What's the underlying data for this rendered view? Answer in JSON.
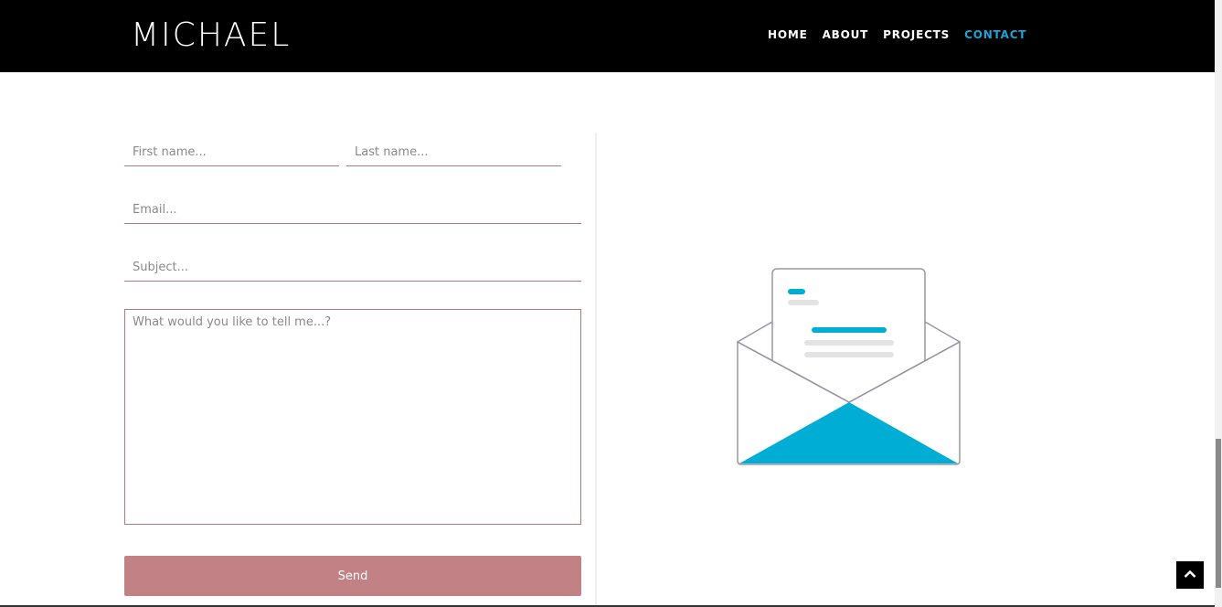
{
  "header": {
    "logo": "MICHAEL",
    "nav": [
      "HOME",
      "ABOUT",
      "PROJECTS",
      "CONTACT"
    ],
    "active_nav": "CONTACT"
  },
  "form": {
    "first_name_placeholder": "First name...",
    "last_name_placeholder": "Last name...",
    "email_placeholder": "Email...",
    "subject_placeholder": "Subject...",
    "message_placeholder": "What would you like to tell me...?",
    "send_label": "Send"
  },
  "colors": {
    "accent": "#1aa3d6",
    "button": "#c28184",
    "field_border": "#b07882",
    "nav_bg": "#000000"
  },
  "icons": {
    "illustration": "open-envelope-icon",
    "scroll_top": "chevron-up-icon"
  }
}
